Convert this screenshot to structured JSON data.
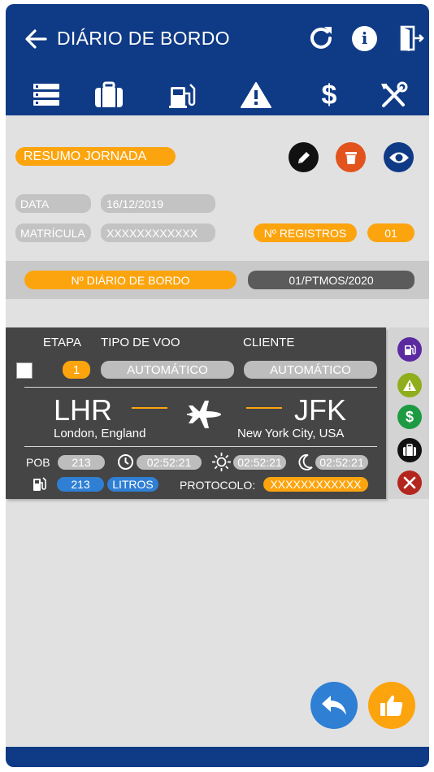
{
  "header": {
    "title": "DIÁRIO DE BORDO",
    "actions": {
      "info_glyph": "i"
    },
    "nav_icons": [
      "list-icon",
      "briefcase-icon",
      "fuel-icon",
      "warning-icon",
      "dollar-icon",
      "tools-icon"
    ]
  },
  "summary": {
    "title": "RESUMO JORNADA",
    "data_label": "DATA",
    "data_value": "16/12/2019",
    "matricula_label": "MATRÍCULA",
    "matricula_value": "XXXXXXXXXXXX",
    "registros_label": "Nº REGISTROS",
    "registros_value": "01",
    "diario_label": "Nº DIÁRIO DE BORDO",
    "diario_value": "01/PTMOS/2020"
  },
  "flight": {
    "etapa_label": "ETAPA",
    "etapa_value": "1",
    "tipo_voo_label": "TIPO DE VOO",
    "tipo_voo_value": "AUTOMÁTICO",
    "cliente_label": "CLIENTE",
    "cliente_value": "AUTOMÁTICO",
    "origin_code": "LHR",
    "origin_city": "London, England",
    "dest_code": "JFK",
    "dest_city": "New York City, USA",
    "pob_label": "POB",
    "pob_value": "213",
    "time_block": "02:52:21",
    "time_day": "02:52:21",
    "time_night": "02:52:21",
    "fuel_value": "213",
    "fuel_unit": "LITROS",
    "protocolo_label": "PROTOCOLO:",
    "protocolo_value": "XXXXXXXXXXXX"
  },
  "colors": {
    "brand_blue": "#0f3a86",
    "accent_orange": "#fca40e",
    "delete_orange": "#e2531d",
    "blue_pill": "#2f7fd4",
    "side_purple": "#5b2aa0",
    "side_olive": "#8fae1b",
    "side_green": "#1e9a43",
    "side_red": "#b3261e"
  }
}
